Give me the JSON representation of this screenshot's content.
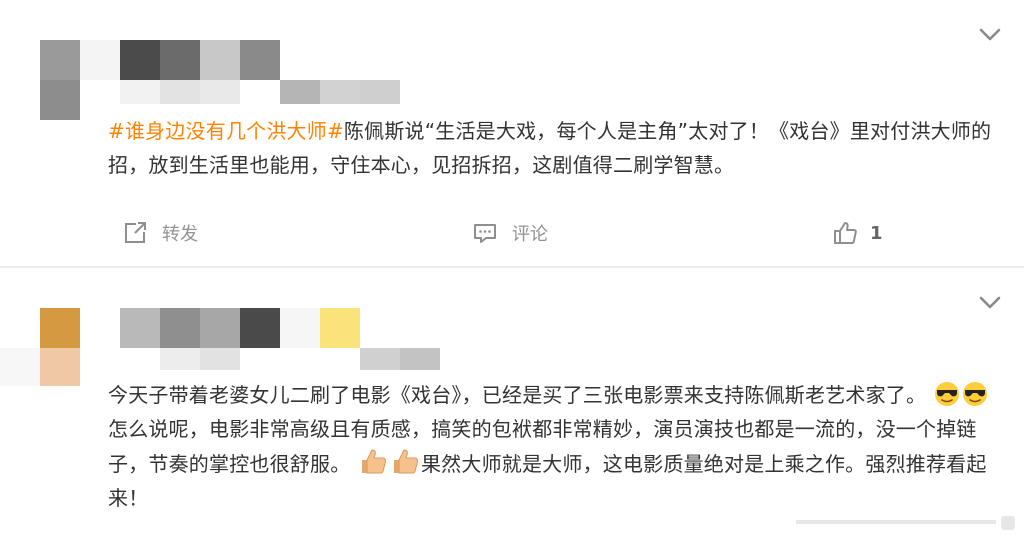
{
  "post1": {
    "tag": "#谁身边没有几个洪大师#",
    "text": "陈佩斯说“生活是大戏，每个人是主角”太对了！《戏台》里对付洪大师的招，放到生活里也能用，守住本心，见招拆招，这剧值得二刷学智慧。",
    "repost_label": "转发",
    "comment_label": "评论",
    "like_count": "1"
  },
  "post2": {
    "text_a": "今天子带着老婆女儿二刷了电影《戏台》，已经是买了三张电影票来支持陈佩斯老艺术家了。",
    "text_b": "怎么说呢，电影非常高级且有质感，搞笑的包袱都非常精妙，演员演技也都是一流的，没一个掉链子，节奏的掌控也很舒服。",
    "text_c": "果然大师就是大师，这电影质量绝对是上乘之作。强烈推荐看起来！"
  },
  "icons": {
    "chevron": "chevron-down-icon",
    "repost": "repost-icon",
    "comment": "comment-icon",
    "like": "thumbs-up-icon",
    "emoji_sunglasses": "sunglasses-emoji",
    "emoji_thumbsup": "thumbs-up-emoji"
  },
  "colors": {
    "topic": "#ff8200",
    "muted": "#939393",
    "text": "#333333"
  }
}
